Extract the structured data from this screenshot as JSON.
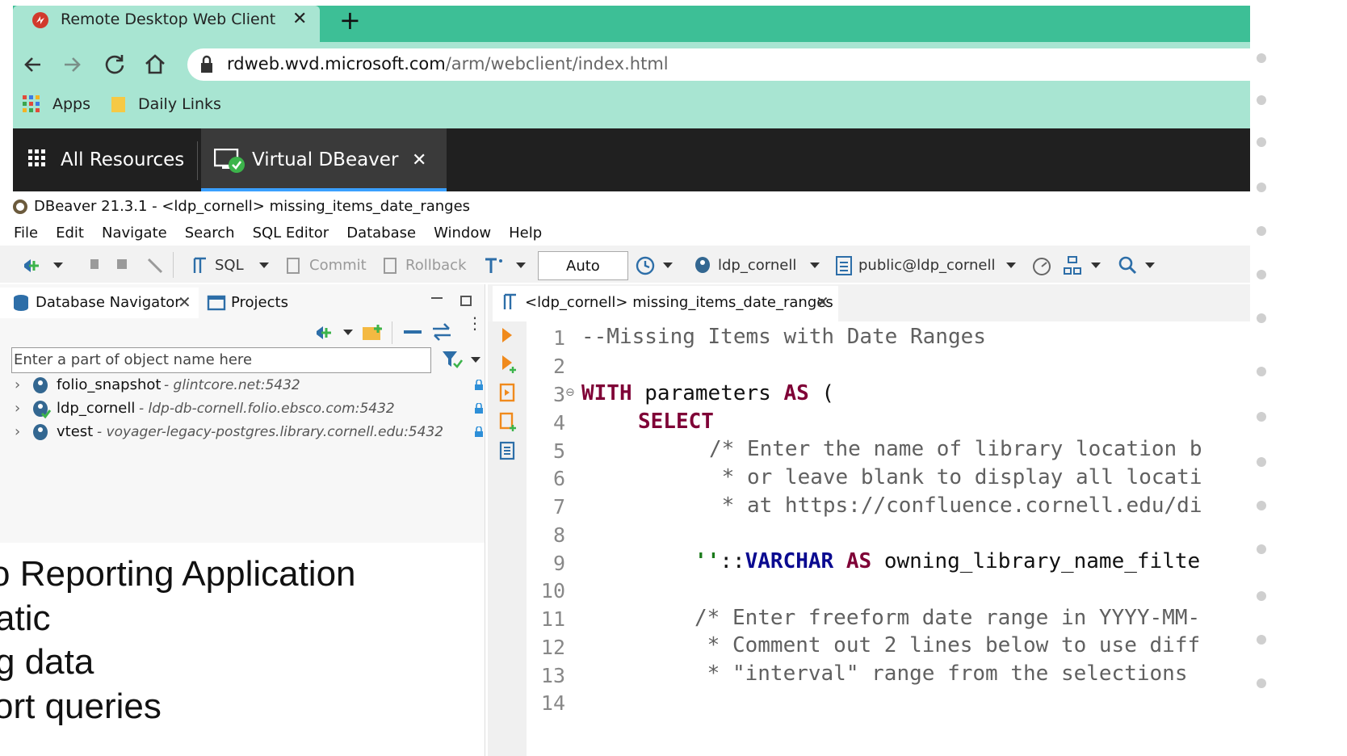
{
  "browser": {
    "tab_title": "Remote Desktop Web Client",
    "tab_close": "✕",
    "new_tab": "+",
    "url_domain": "rdweb.wvd.microsoft.com",
    "url_path": "/arm/webclient/index.html",
    "bookmarks": [
      "Apps",
      "Daily Links"
    ]
  },
  "remote_desktop": {
    "all_resources": "All Resources",
    "session_tab": "Virtual DBeaver",
    "session_close": "✕"
  },
  "dbeaver": {
    "window_title": "DBeaver 21.3.1 - <ldp_cornell> missing_items_date_ranges",
    "menu": [
      "File",
      "Edit",
      "Navigate",
      "Search",
      "SQL Editor",
      "Database",
      "Window",
      "Help"
    ],
    "toolbar": {
      "sql": "SQL",
      "commit": "Commit",
      "rollback": "Rollback",
      "auto": "Auto",
      "connection": "ldp_cornell",
      "schema": "public@ldp_cornell"
    }
  },
  "navigator": {
    "tab_label": "Database Navigator",
    "projects_label": "Projects",
    "filter_placeholder": "Enter a part of object name here",
    "connections": [
      {
        "name": "folio_snapshot",
        "host": "- glintcore.net:5432"
      },
      {
        "name": "ldp_cornell",
        "host": "- ldp-db-cornell.folio.ebsco.com:5432"
      },
      {
        "name": "vtest",
        "host": "- voyager-legacy-postgres.library.cornell.edu:5432"
      }
    ]
  },
  "editor": {
    "tab_label": "<ldp_cornell> missing_items_date_ranges",
    "line_numbers": [
      "1",
      "2",
      "3",
      "4",
      "5",
      "6",
      "7",
      "8",
      "9",
      "10",
      "11",
      "12",
      "13",
      "14"
    ],
    "lines": {
      "l1": "--Missing Items with Date Ranges",
      "l3_kw": "WITH",
      "l3_rest": " parameters ",
      "l3_as": "AS",
      "l3_paren": " (",
      "l4": "SELECT",
      "l5": "/* Enter the name of library location b",
      "l6": " * or leave blank to display all locati",
      "l7": " * at https://confluence.cornell.edu/di",
      "l9_str": "''",
      "l9_cast": "::",
      "l9_type": "VARCHAR",
      "l9_as": "AS",
      "l9_rest": " owning_library_name_filte",
      "l11": "/* Enter freeform date range in YYYY-MM-",
      "l12": " * Comment out 2 lines below to use diff",
      "l13": " * \"interval\" range from the selections"
    }
  },
  "overlay_text": [
    "o Reporting Application",
    "atic",
    "g data",
    "ort queries"
  ]
}
